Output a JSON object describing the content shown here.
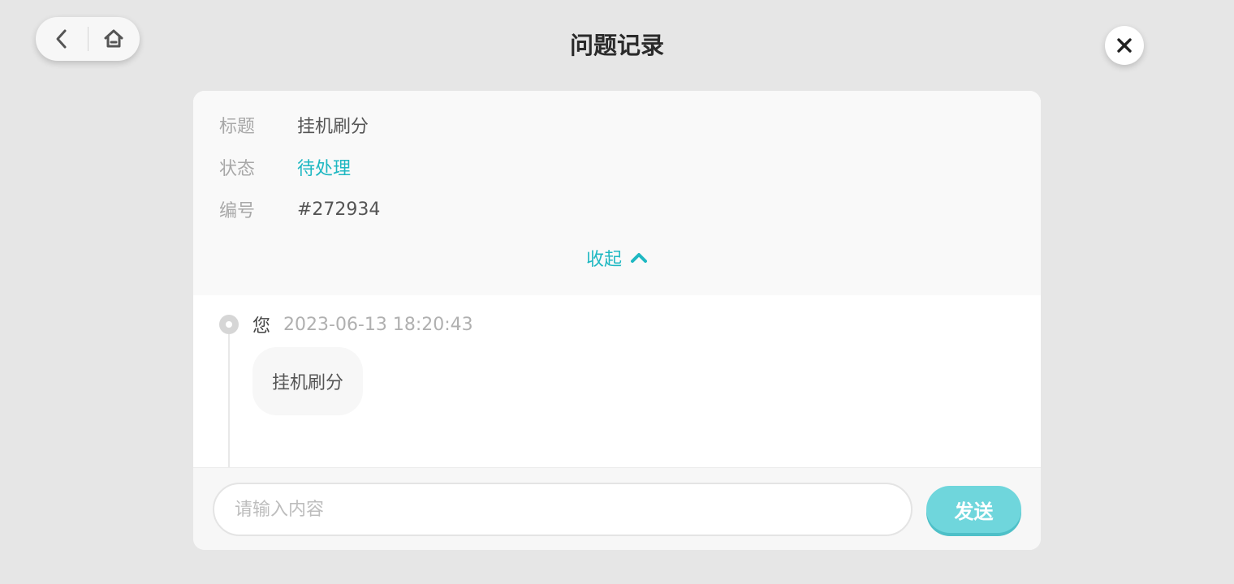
{
  "header": {
    "title": "问题记录",
    "back_icon": "chevron-left-icon",
    "home_icon": "home-icon",
    "close_icon": "close-icon"
  },
  "info": {
    "title_label": "标题",
    "title_value": "挂机刷分",
    "status_label": "状态",
    "status_value": "待处理",
    "id_label": "编号",
    "id_value": "#272934",
    "collapse_label": "收起",
    "collapse_icon": "chevron-up-icon"
  },
  "messages": [
    {
      "author": "您",
      "time": "2023-06-13 18:20:43",
      "text": "挂机刷分"
    }
  ],
  "composer": {
    "placeholder": "请输入内容",
    "value": "",
    "send_label": "发送"
  },
  "colors": {
    "accent": "#1fb8c2",
    "send_button": "#6fd6dc",
    "background": "#e6e6e6"
  }
}
